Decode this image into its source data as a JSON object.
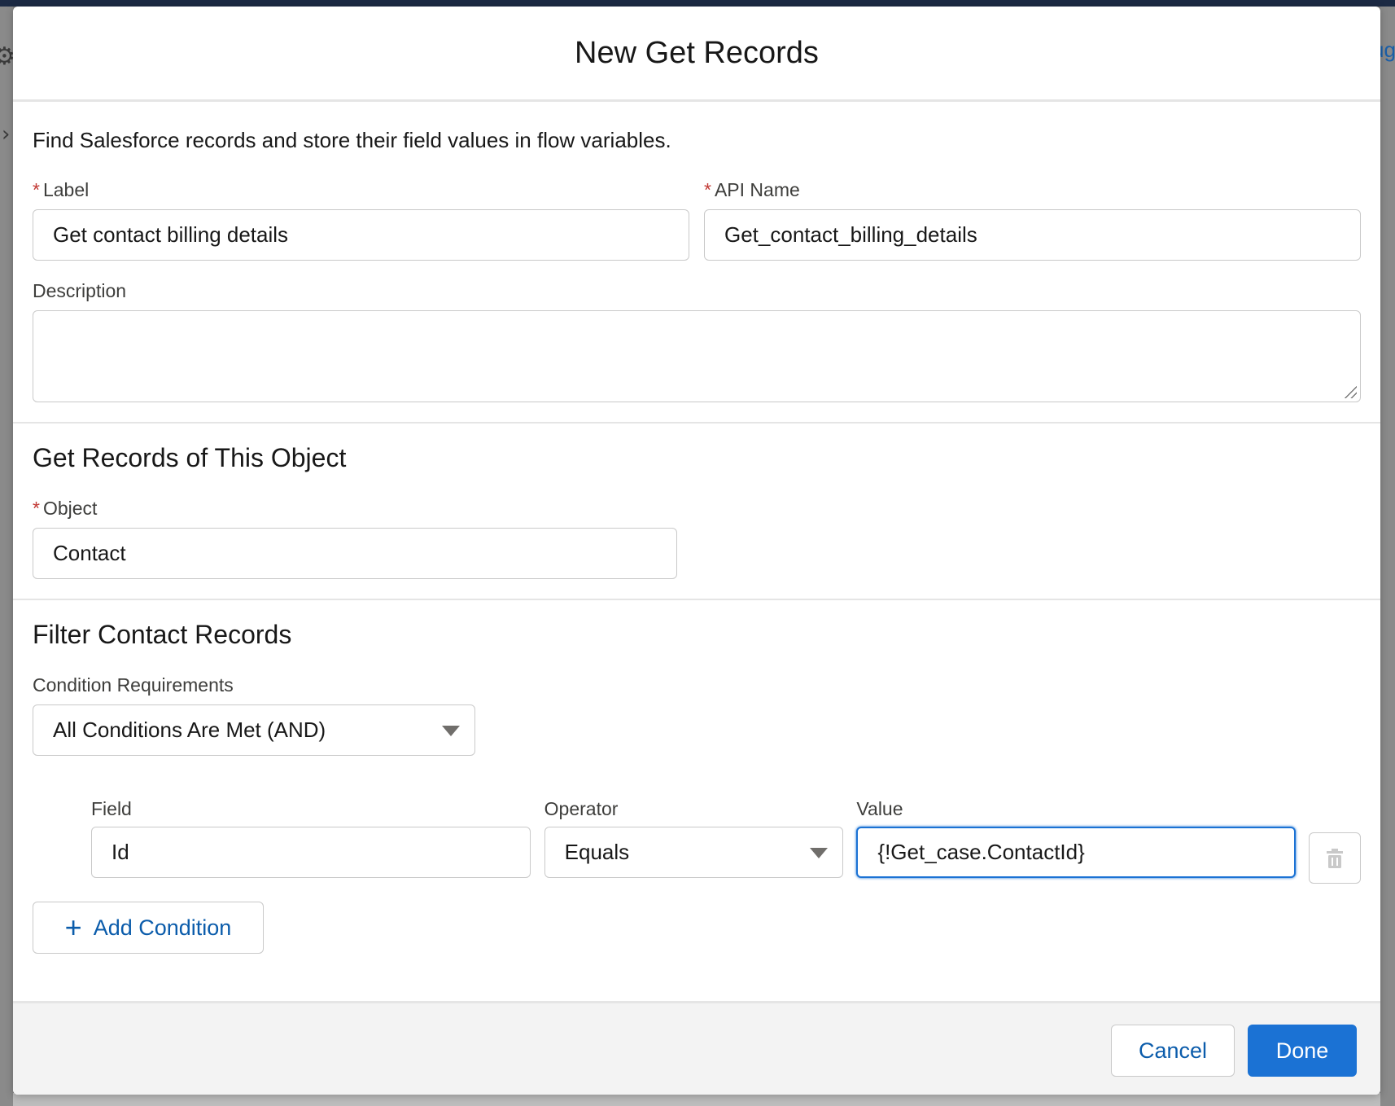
{
  "background": {
    "right_partial_text": "ug"
  },
  "modal": {
    "title": "New Get Records",
    "intro": "Find Salesforce records and store their field values in flow variables.",
    "label_field": {
      "label": "Label",
      "required_mark": "*",
      "value": "Get contact billing details"
    },
    "api_name_field": {
      "label": "API Name",
      "required_mark": "*",
      "value": "Get_contact_billing_details"
    },
    "description_field": {
      "label": "Description",
      "value": ""
    },
    "object_section": {
      "title": "Get Records of This Object",
      "object_field": {
        "label": "Object",
        "required_mark": "*",
        "value": "Contact"
      }
    },
    "filter_section": {
      "title": "Filter Contact Records",
      "condition_requirements": {
        "label": "Condition Requirements",
        "value": "All Conditions Are Met (AND)"
      },
      "conditions": [
        {
          "field_label": "Field",
          "field_value": "Id",
          "operator_label": "Operator",
          "operator_value": "Equals",
          "value_label": "Value",
          "value_value": "{!Get_case.ContactId}"
        }
      ],
      "add_condition_label": "Add Condition"
    },
    "footer": {
      "cancel_label": "Cancel",
      "done_label": "Done"
    }
  },
  "colors": {
    "brand_button": "#1b72d4",
    "link_blue": "#0b5cab",
    "required_red": "#c23934",
    "focus_border": "#1b72d4"
  },
  "icons": [
    "gear-icon",
    "chevron-right-icon",
    "resize-grip-icon",
    "chevron-down-icon",
    "trash-icon",
    "plus-icon"
  ]
}
